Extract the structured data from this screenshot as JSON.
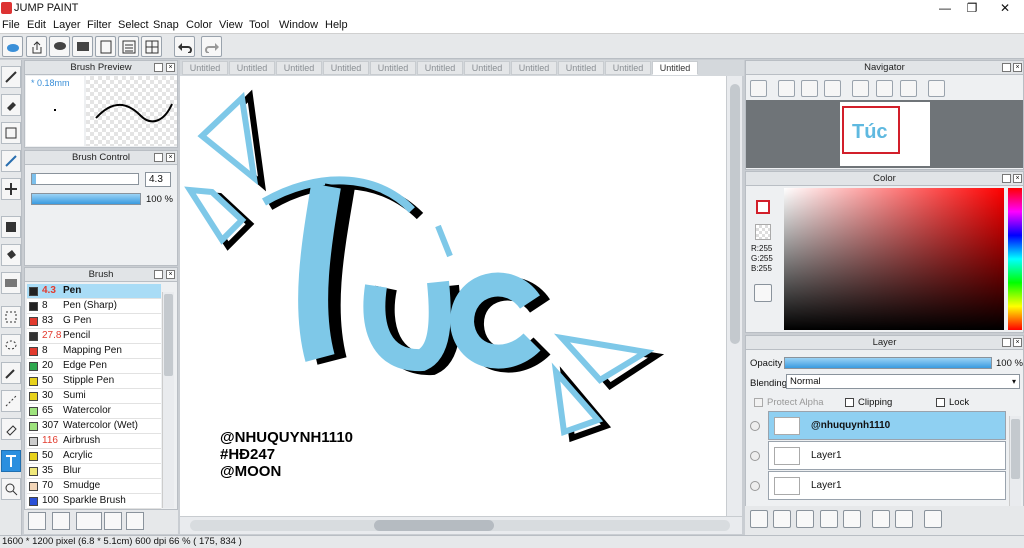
{
  "window": {
    "title": "JUMP PAINT",
    "minimize": "—",
    "maximize": "❐",
    "close": "✕"
  },
  "menu": [
    "File",
    "Edit",
    "Layer",
    "Filter",
    "Select",
    "Snap",
    "Color",
    "View",
    "Tool",
    "Window",
    "Help"
  ],
  "brush_preview": {
    "title": "Brush Preview",
    "size": "* 0.18mm"
  },
  "brush_control": {
    "title": "Brush Control",
    "size_value": "4.3",
    "opacity_value": "100 %",
    "opacity": 1.0
  },
  "brush": {
    "title": "Brush",
    "items": [
      {
        "size": "4.3",
        "name": "Pen",
        "color": "#222222",
        "selected": true
      },
      {
        "size": "8",
        "name": "Pen (Sharp)",
        "color": "#222222"
      },
      {
        "size": "83",
        "name": "G Pen",
        "color": "#e23b2e"
      },
      {
        "size": "27.8",
        "name": "Pencil",
        "color": "#333333"
      },
      {
        "size": "8",
        "name": "Mapping Pen",
        "color": "#e23b2e"
      },
      {
        "size": "20",
        "name": "Edge Pen",
        "color": "#2fa84f"
      },
      {
        "size": "50",
        "name": "Stipple Pen",
        "color": "#e8d21c"
      },
      {
        "size": "30",
        "name": "Sumi",
        "color": "#e8d21c"
      },
      {
        "size": "65",
        "name": "Watercolor",
        "color": "#9ee37d"
      },
      {
        "size": "307",
        "name": "Watercolor (Wet)",
        "color": "#9ee37d"
      },
      {
        "size": "116",
        "name": "Airbrush",
        "color": "#cccccc"
      },
      {
        "size": "50",
        "name": "Acrylic",
        "color": "#e8d21c"
      },
      {
        "size": "35",
        "name": "Blur",
        "color": "#f0e87a"
      },
      {
        "size": "70",
        "name": "Smudge",
        "color": "#f3d6b8"
      },
      {
        "size": "100",
        "name": "Sparkle Brush",
        "color": "#2a4fd6"
      }
    ]
  },
  "tabs": [
    "Untitled",
    "Untitled",
    "Untitled",
    "Untitled",
    "Untitled",
    "Untitled",
    "Untitled",
    "Untitled",
    "Untitled",
    "Untitled",
    "Untitled"
  ],
  "canvas": {
    "lettering": "Túc",
    "credits": [
      "@NHUQUYNH1110",
      "#HĐ247",
      "@MOON"
    ]
  },
  "navigator": {
    "title": "Navigator"
  },
  "color": {
    "title": "Color",
    "r": "R:255",
    "g": "G:255",
    "b": "B:255"
  },
  "layer": {
    "title": "Layer",
    "opacity_label": "Opacity",
    "opacity_value": "100 %",
    "blending_label": "Blending",
    "blending_value": "Normal",
    "protect_alpha": "Protect Alpha",
    "clipping": "Clipping",
    "lock": "Lock",
    "layers": [
      {
        "name": "@nhuquynh1110",
        "selected": true
      },
      {
        "name": "Layer1"
      },
      {
        "name": "Layer1"
      }
    ]
  },
  "status": {
    "text": "1600 * 1200 pixel  (6.8 * 5.1cm)  600 dpi  66 %  ( 175, 834 )"
  },
  "colors": {
    "accent": "#2b8fdf",
    "lettering": "#7ec8e8",
    "selection": "#8fd0f2"
  }
}
